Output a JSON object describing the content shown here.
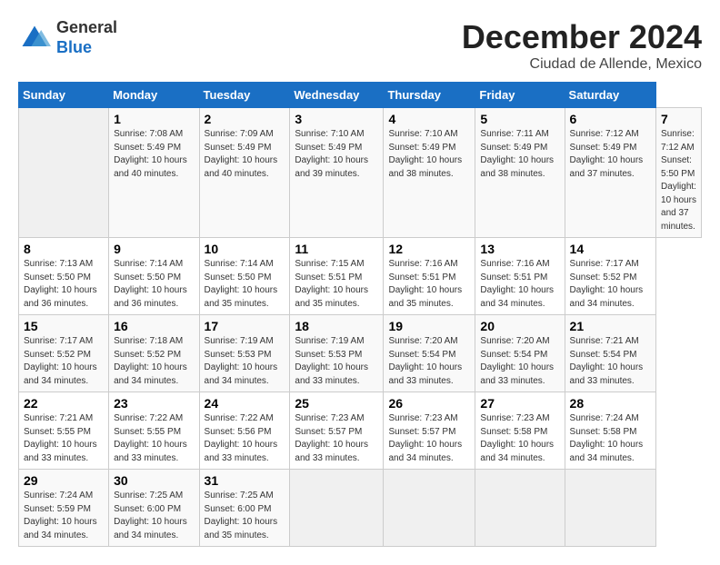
{
  "logo": {
    "general": "General",
    "blue": "Blue"
  },
  "header": {
    "title": "December 2024",
    "subtitle": "Ciudad de Allende, Mexico"
  },
  "weekdays": [
    "Sunday",
    "Monday",
    "Tuesday",
    "Wednesday",
    "Thursday",
    "Friday",
    "Saturday"
  ],
  "days": [
    {
      "date": "",
      "sunrise": "",
      "sunset": "",
      "daylight": ""
    },
    {
      "date": "1",
      "sunrise": "Sunrise: 7:08 AM",
      "sunset": "Sunset: 5:49 PM",
      "daylight": "Daylight: 10 hours and 40 minutes."
    },
    {
      "date": "2",
      "sunrise": "Sunrise: 7:09 AM",
      "sunset": "Sunset: 5:49 PM",
      "daylight": "Daylight: 10 hours and 40 minutes."
    },
    {
      "date": "3",
      "sunrise": "Sunrise: 7:10 AM",
      "sunset": "Sunset: 5:49 PM",
      "daylight": "Daylight: 10 hours and 39 minutes."
    },
    {
      "date": "4",
      "sunrise": "Sunrise: 7:10 AM",
      "sunset": "Sunset: 5:49 PM",
      "daylight": "Daylight: 10 hours and 38 minutes."
    },
    {
      "date": "5",
      "sunrise": "Sunrise: 7:11 AM",
      "sunset": "Sunset: 5:49 PM",
      "daylight": "Daylight: 10 hours and 38 minutes."
    },
    {
      "date": "6",
      "sunrise": "Sunrise: 7:12 AM",
      "sunset": "Sunset: 5:49 PM",
      "daylight": "Daylight: 10 hours and 37 minutes."
    },
    {
      "date": "7",
      "sunrise": "Sunrise: 7:12 AM",
      "sunset": "Sunset: 5:50 PM",
      "daylight": "Daylight: 10 hours and 37 minutes."
    },
    {
      "date": "8",
      "sunrise": "Sunrise: 7:13 AM",
      "sunset": "Sunset: 5:50 PM",
      "daylight": "Daylight: 10 hours and 36 minutes."
    },
    {
      "date": "9",
      "sunrise": "Sunrise: 7:14 AM",
      "sunset": "Sunset: 5:50 PM",
      "daylight": "Daylight: 10 hours and 36 minutes."
    },
    {
      "date": "10",
      "sunrise": "Sunrise: 7:14 AM",
      "sunset": "Sunset: 5:50 PM",
      "daylight": "Daylight: 10 hours and 35 minutes."
    },
    {
      "date": "11",
      "sunrise": "Sunrise: 7:15 AM",
      "sunset": "Sunset: 5:51 PM",
      "daylight": "Daylight: 10 hours and 35 minutes."
    },
    {
      "date": "12",
      "sunrise": "Sunrise: 7:16 AM",
      "sunset": "Sunset: 5:51 PM",
      "daylight": "Daylight: 10 hours and 35 minutes."
    },
    {
      "date": "13",
      "sunrise": "Sunrise: 7:16 AM",
      "sunset": "Sunset: 5:51 PM",
      "daylight": "Daylight: 10 hours and 34 minutes."
    },
    {
      "date": "14",
      "sunrise": "Sunrise: 7:17 AM",
      "sunset": "Sunset: 5:52 PM",
      "daylight": "Daylight: 10 hours and 34 minutes."
    },
    {
      "date": "15",
      "sunrise": "Sunrise: 7:17 AM",
      "sunset": "Sunset: 5:52 PM",
      "daylight": "Daylight: 10 hours and 34 minutes."
    },
    {
      "date": "16",
      "sunrise": "Sunrise: 7:18 AM",
      "sunset": "Sunset: 5:52 PM",
      "daylight": "Daylight: 10 hours and 34 minutes."
    },
    {
      "date": "17",
      "sunrise": "Sunrise: 7:19 AM",
      "sunset": "Sunset: 5:53 PM",
      "daylight": "Daylight: 10 hours and 34 minutes."
    },
    {
      "date": "18",
      "sunrise": "Sunrise: 7:19 AM",
      "sunset": "Sunset: 5:53 PM",
      "daylight": "Daylight: 10 hours and 33 minutes."
    },
    {
      "date": "19",
      "sunrise": "Sunrise: 7:20 AM",
      "sunset": "Sunset: 5:54 PM",
      "daylight": "Daylight: 10 hours and 33 minutes."
    },
    {
      "date": "20",
      "sunrise": "Sunrise: 7:20 AM",
      "sunset": "Sunset: 5:54 PM",
      "daylight": "Daylight: 10 hours and 33 minutes."
    },
    {
      "date": "21",
      "sunrise": "Sunrise: 7:21 AM",
      "sunset": "Sunset: 5:54 PM",
      "daylight": "Daylight: 10 hours and 33 minutes."
    },
    {
      "date": "22",
      "sunrise": "Sunrise: 7:21 AM",
      "sunset": "Sunset: 5:55 PM",
      "daylight": "Daylight: 10 hours and 33 minutes."
    },
    {
      "date": "23",
      "sunrise": "Sunrise: 7:22 AM",
      "sunset": "Sunset: 5:55 PM",
      "daylight": "Daylight: 10 hours and 33 minutes."
    },
    {
      "date": "24",
      "sunrise": "Sunrise: 7:22 AM",
      "sunset": "Sunset: 5:56 PM",
      "daylight": "Daylight: 10 hours and 33 minutes."
    },
    {
      "date": "25",
      "sunrise": "Sunrise: 7:23 AM",
      "sunset": "Sunset: 5:57 PM",
      "daylight": "Daylight: 10 hours and 33 minutes."
    },
    {
      "date": "26",
      "sunrise": "Sunrise: 7:23 AM",
      "sunset": "Sunset: 5:57 PM",
      "daylight": "Daylight: 10 hours and 34 minutes."
    },
    {
      "date": "27",
      "sunrise": "Sunrise: 7:23 AM",
      "sunset": "Sunset: 5:58 PM",
      "daylight": "Daylight: 10 hours and 34 minutes."
    },
    {
      "date": "28",
      "sunrise": "Sunrise: 7:24 AM",
      "sunset": "Sunset: 5:58 PM",
      "daylight": "Daylight: 10 hours and 34 minutes."
    },
    {
      "date": "29",
      "sunrise": "Sunrise: 7:24 AM",
      "sunset": "Sunset: 5:59 PM",
      "daylight": "Daylight: 10 hours and 34 minutes."
    },
    {
      "date": "30",
      "sunrise": "Sunrise: 7:25 AM",
      "sunset": "Sunset: 6:00 PM",
      "daylight": "Daylight: 10 hours and 34 minutes."
    },
    {
      "date": "31",
      "sunrise": "Sunrise: 7:25 AM",
      "sunset": "Sunset: 6:00 PM",
      "daylight": "Daylight: 10 hours and 35 minutes."
    }
  ]
}
